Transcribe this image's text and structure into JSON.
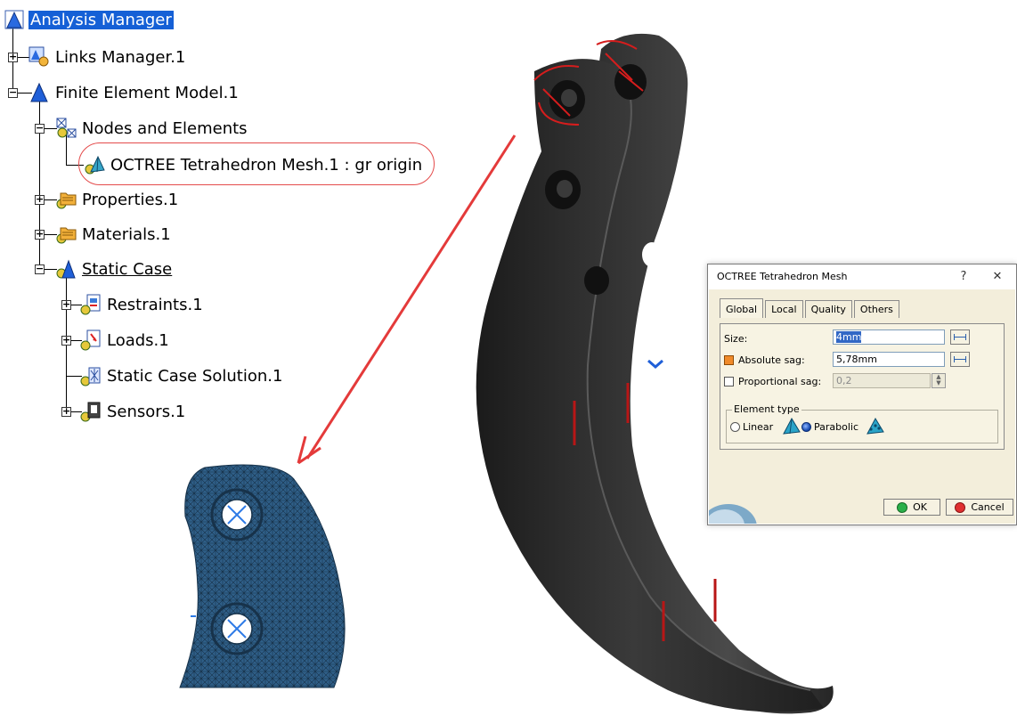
{
  "tree": {
    "root": "Analysis Manager",
    "links_manager": "Links Manager.1",
    "fem": "Finite Element Model.1",
    "nodes_elements": "Nodes and Elements",
    "octree_mesh": "OCTREE Tetrahedron Mesh.1 : gr origin",
    "properties": "Properties.1",
    "materials": "Materials.1",
    "static_case": "Static Case",
    "restraints": "Restraints.1",
    "loads": "Loads.1",
    "static_solution": "Static Case Solution.1",
    "sensors": "Sensors.1"
  },
  "dialog": {
    "title": "OCTREE Tetrahedron Mesh",
    "help": "?",
    "close": "✕",
    "tabs": [
      "Global",
      "Local",
      "Quality",
      "Others"
    ],
    "active_tab": "Global",
    "size_label": "Size:",
    "size_value": "4mm",
    "abs_sag_label": "Absolute sag:",
    "abs_sag_value": "5,78mm",
    "abs_sag_checked": true,
    "prop_sag_label": "Proportional sag:",
    "prop_sag_value": "0,2",
    "prop_sag_checked": false,
    "element_type_title": "Element type",
    "linear_label": "Linear",
    "parabolic_label": "Parabolic",
    "selected_element_type": "Parabolic",
    "ok_label": "OK",
    "cancel_label": "Cancel"
  },
  "colors": {
    "selection": "#1560d6",
    "annotation": "#e43a3a",
    "mesh": "#2f5f88",
    "part": "#2a2a2a",
    "dialog_bg": "#f3eedb"
  }
}
